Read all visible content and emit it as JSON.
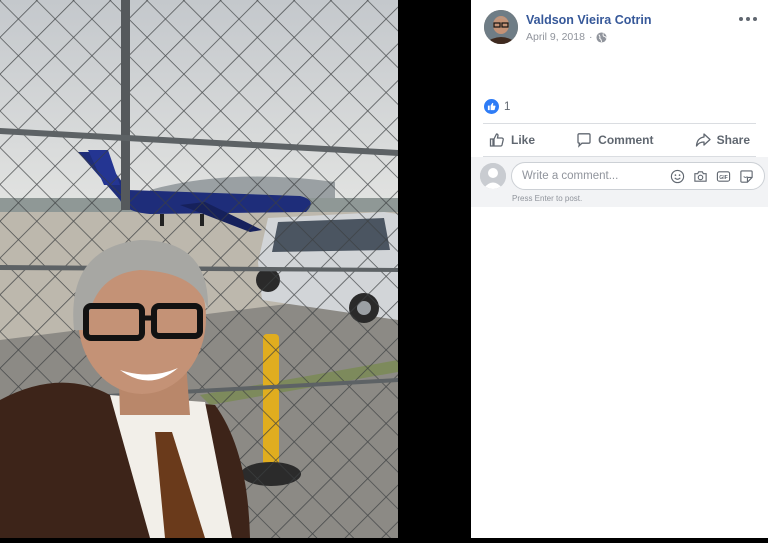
{
  "post": {
    "author": "Valdson Vieira Cotrin",
    "date": "April 9, 2018",
    "privacy_icon": "globe-icon",
    "reaction_count": "1"
  },
  "actions": {
    "like": "Like",
    "comment": "Comment",
    "share": "Share"
  },
  "comment_box": {
    "placeholder": "Write a comment...",
    "hint": "Press Enter to post.",
    "icons": [
      "emoji-icon",
      "camera-icon",
      "gif-icon",
      "sticker-icon"
    ]
  },
  "colors": {
    "author_link": "#365899",
    "like_blue": "#2e7cf6",
    "muted": "#606770"
  }
}
